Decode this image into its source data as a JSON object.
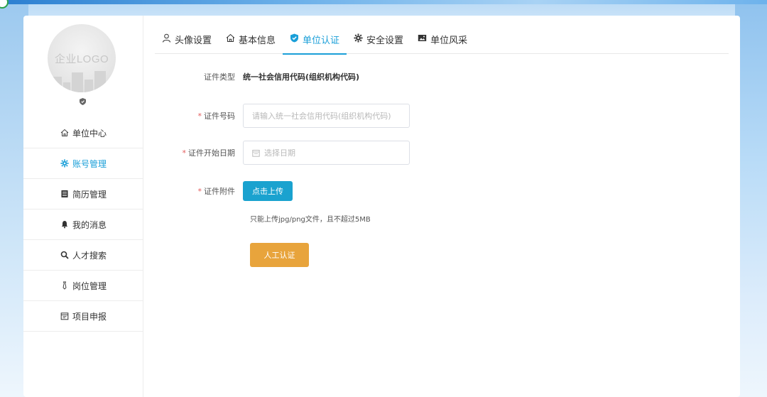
{
  "avatar": {
    "text": "企业LOGO"
  },
  "sidebar": {
    "items": [
      {
        "label": "单位中心",
        "icon": "home-icon"
      },
      {
        "label": "账号管理",
        "icon": "gear-icon",
        "active": true
      },
      {
        "label": "简历管理",
        "icon": "document-icon"
      },
      {
        "label": "我的消息",
        "icon": "bell-icon"
      },
      {
        "label": "人才搜索",
        "icon": "search-icon"
      },
      {
        "label": "岗位管理",
        "icon": "tie-icon"
      },
      {
        "label": "项目申报",
        "icon": "calendar-icon"
      }
    ]
  },
  "tabs": [
    {
      "label": "头像设置",
      "icon": "user-icon"
    },
    {
      "label": "基本信息",
      "icon": "home-icon"
    },
    {
      "label": "单位认证",
      "icon": "shield-check-icon",
      "active": true
    },
    {
      "label": "安全设置",
      "icon": "gear-icon"
    },
    {
      "label": "单位风采",
      "icon": "image-icon"
    }
  ],
  "form": {
    "cert_type_label": "证件类型",
    "cert_type_value": "统一社会信用代码(组织机构代码)",
    "cert_no_label": "证件号码",
    "cert_no_placeholder": "请输入统一社会信用代码(组织机构代码)",
    "start_date_label": "证件开始日期",
    "start_date_placeholder": "选择日期",
    "attachment_label": "证件附件",
    "upload_button": "点击上传",
    "hint": "只能上传jpg/png文件，且不超过5MB",
    "manual_button": "人工认证",
    "required_mark": "*"
  },
  "colors": {
    "accent": "#1a9fd8",
    "upload": "#1aa2cf",
    "manual": "#e8a43c",
    "required": "#e35b5b"
  }
}
